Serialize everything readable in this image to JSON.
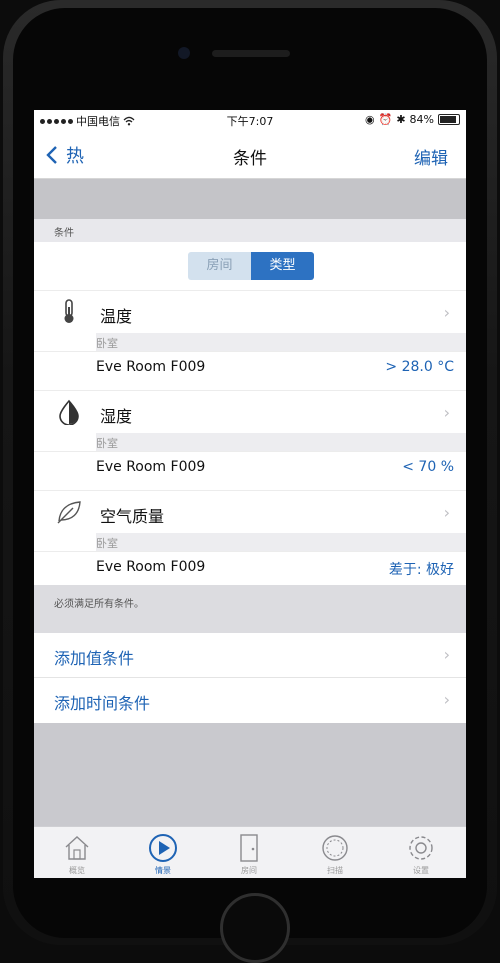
{
  "status_bar": {
    "carrier": "中国电信",
    "time": "下午7:07",
    "battery": "84%"
  },
  "nav": {
    "back_label": "热",
    "title": "条件",
    "edit_label": "编辑"
  },
  "section_header": "条件",
  "segment": {
    "options": [
      "房间",
      "类型"
    ],
    "selected": "类型"
  },
  "conditions": [
    {
      "icon": "thermometer-icon",
      "label": "温度",
      "room": "卧室",
      "device": "Eve Room F009",
      "value": "> 28.0 °C"
    },
    {
      "icon": "water-drop-icon",
      "label": "湿度",
      "room": "卧室",
      "device": "Eve Room F009",
      "value": "< 70 %"
    },
    {
      "icon": "leaf-icon",
      "label": "空气质量",
      "room": "卧室",
      "device": "Eve Room F009",
      "value": "差于: 极好"
    }
  ],
  "footnote": "必须满足所有条件。",
  "actions": [
    {
      "label": "添加值条件"
    },
    {
      "label": "添加时间条件"
    }
  ],
  "tabs": [
    {
      "icon": "home-icon",
      "label": "概览",
      "active": false
    },
    {
      "icon": "play-icon",
      "label": "情景",
      "active": true
    },
    {
      "icon": "door-icon",
      "label": "房间",
      "active": false
    },
    {
      "icon": "scan-icon",
      "label": "扫描",
      "active": false
    },
    {
      "icon": "gear-icon",
      "label": "设置",
      "active": false
    }
  ],
  "colors": {
    "accent": "#1e63b4",
    "segment_selected": "#2d72c2",
    "background_gray": "#c9c9ce"
  }
}
